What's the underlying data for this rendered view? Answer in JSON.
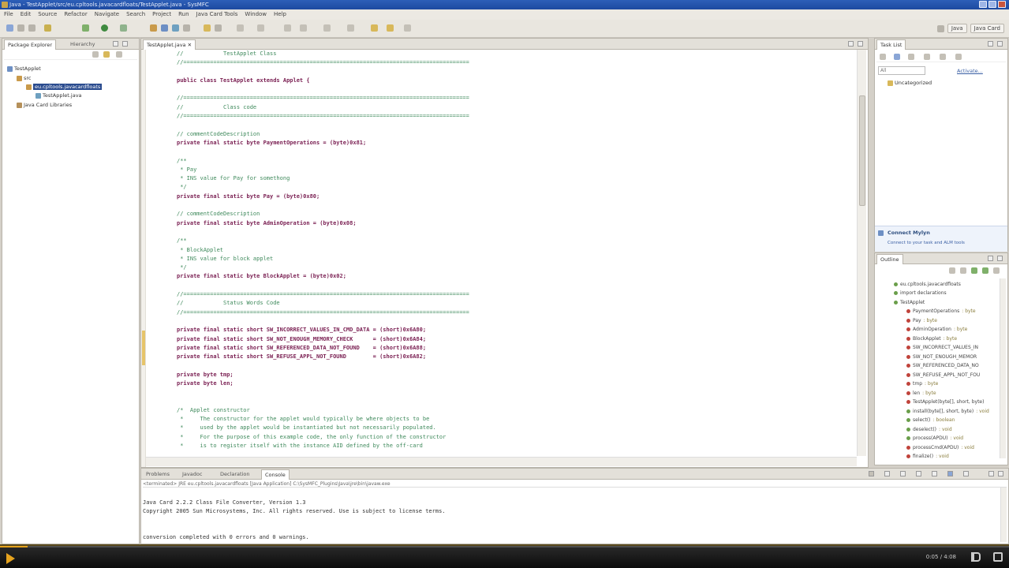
{
  "window": {
    "title": "Java - TestApplet/src/eu.cpltools.javacardfloats/TestApplet.java - SysMFC"
  },
  "menu": [
    "File",
    "Edit",
    "Source",
    "Refactor",
    "Navigate",
    "Search",
    "Project",
    "Run",
    "Java Card Tools",
    "Window",
    "Help"
  ],
  "perspective": {
    "java": "Java",
    "other": "Java Card"
  },
  "explorer": {
    "tabs": [
      "Package Explorer",
      "Hierarchy"
    ],
    "tree": [
      "TestApplet",
      "src",
      "eu.cpltools.javacardfloats",
      "TestApplet.java",
      "Java Card Libraries"
    ]
  },
  "editor": {
    "tab": "TestApplet.java",
    "lines": [
      {
        "t": "c",
        "s": "//            TestApplet Class"
      },
      {
        "t": "c",
        "s": "//======================================================================================"
      },
      {
        "t": "",
        "s": ""
      },
      {
        "t": "k",
        "s": "public class TestApplet extends Applet {"
      },
      {
        "t": "",
        "s": ""
      },
      {
        "t": "c",
        "s": "//======================================================================================"
      },
      {
        "t": "c",
        "s": "//            Class code"
      },
      {
        "t": "c",
        "s": "//======================================================================================"
      },
      {
        "t": "",
        "s": ""
      },
      {
        "t": "c",
        "s": "// commentCodeDescription"
      },
      {
        "t": "k",
        "s": "private final static byte PaymentOperations = (byte)0x81;"
      },
      {
        "t": "",
        "s": ""
      },
      {
        "t": "c",
        "s": "/**"
      },
      {
        "t": "c",
        "s": " * Pay"
      },
      {
        "t": "c",
        "s": " * INS value for Pay for somethong"
      },
      {
        "t": "c",
        "s": " */"
      },
      {
        "t": "k",
        "s": "private final static byte Pay = (byte)0x80;"
      },
      {
        "t": "",
        "s": ""
      },
      {
        "t": "c",
        "s": "// commentCodeDescription"
      },
      {
        "t": "k",
        "s": "private final static byte AdminOperation = (byte)0x08;"
      },
      {
        "t": "",
        "s": ""
      },
      {
        "t": "c",
        "s": "/**"
      },
      {
        "t": "c",
        "s": " * BlockApplet"
      },
      {
        "t": "c",
        "s": " * INS value for block applet"
      },
      {
        "t": "c",
        "s": " */"
      },
      {
        "t": "k",
        "s": "private final static byte BlockApplet = (byte)0x02;"
      },
      {
        "t": "",
        "s": ""
      },
      {
        "t": "c",
        "s": "//======================================================================================"
      },
      {
        "t": "c",
        "s": "//            Status Words Code"
      },
      {
        "t": "c",
        "s": "//======================================================================================"
      },
      {
        "t": "",
        "s": ""
      },
      {
        "t": "k",
        "s": "private final static short SW_INCORRECT_VALUES_IN_CMD_DATA = (short)0x6A80;"
      },
      {
        "t": "k",
        "s": "private final static short SW_NOT_ENOUGH_MEMORY_CHECK      = (short)0x6A84;"
      },
      {
        "t": "k",
        "s": "private final static short SW_REFERENCED_DATA_NOT_FOUND    = (short)0x6A88;"
      },
      {
        "t": "k",
        "s": "private final static short SW_REFUSE_APPL_NOT_FOUND        = (short)0x6A82;"
      },
      {
        "t": "",
        "s": ""
      },
      {
        "t": "k",
        "s": "private byte tmp;"
      },
      {
        "t": "k",
        "s": "private byte len;"
      },
      {
        "t": "",
        "s": ""
      },
      {
        "t": "",
        "s": ""
      },
      {
        "t": "c",
        "s": "/*  Applet constructor"
      },
      {
        "t": "c",
        "s": " *     The constructor for the applet would typically be where objects to be"
      },
      {
        "t": "c",
        "s": " *     used by the applet would be instantiated but not necessarily populated."
      },
      {
        "t": "c",
        "s": " *     For the purpose of this example code, the only function of the constructor"
      },
      {
        "t": "c",
        "s": " *     is to register itself with the instance AID defined by the off-card"
      }
    ]
  },
  "console": {
    "tabs": [
      "Problems",
      "Javadoc",
      "Declaration",
      "Console"
    ],
    "path": "<terminated> JRE eu.cpltools.javacardfloats [Java Application] C:\\SysMFC_Plugins\\Java\\jre\\bin\\javaw.exe",
    "lines": [
      "Java Card 2.2.2 Class File Converter, Version 1.3",
      "Copyright 2005 Sun Microsystems, Inc. All rights reserved. Use is subject to license terms.",
      "",
      "",
      "conversion completed with 0 errors and 0 warnings."
    ]
  },
  "tasks": {
    "tab": "Task List",
    "find_label": "All",
    "activate_label": "Activate...",
    "uncategorized": "Uncategorized",
    "connect_title": "Connect Mylyn",
    "connect_text": "Connect to your task and ALM tools"
  },
  "outline": {
    "tab": "Outline",
    "items": [
      {
        "name": "eu.cpltools.javacardfloats",
        "type": "",
        "c": "green"
      },
      {
        "name": "import declarations",
        "type": "",
        "c": "green"
      },
      {
        "name": "TestApplet",
        "type": "",
        "c": "green"
      },
      {
        "name": "PaymentOperations",
        "type": ": byte",
        "c": "red"
      },
      {
        "name": "Pay",
        "type": ": byte",
        "c": "red"
      },
      {
        "name": "AdminOperation",
        "type": ": byte",
        "c": "red"
      },
      {
        "name": "BlockApplet",
        "type": ": byte",
        "c": "red"
      },
      {
        "name": "SW_INCORRECT_VALUES_IN",
        "type": "",
        "c": "red"
      },
      {
        "name": "SW_NOT_ENOUGH_MEMOR",
        "type": "",
        "c": "red"
      },
      {
        "name": "SW_REFERENCED_DATA_NO",
        "type": "",
        "c": "red"
      },
      {
        "name": "SW_REFUSE_APPL_NOT_FOU",
        "type": "",
        "c": "red"
      },
      {
        "name": "tmp",
        "type": ": byte",
        "c": "red"
      },
      {
        "name": "len",
        "type": ": byte",
        "c": "red"
      },
      {
        "name": "TestApplet(byte[], short, byte)",
        "type": "",
        "c": "red"
      },
      {
        "name": "install(byte[], short, byte)",
        "type": ": void",
        "c": "green"
      },
      {
        "name": "select()",
        "type": ": boolean",
        "c": "green"
      },
      {
        "name": "deselect()",
        "type": ": void",
        "c": "green"
      },
      {
        "name": "process(APDU)",
        "type": ": void",
        "c": "green"
      },
      {
        "name": "processCmd(APDU)",
        "type": ": void",
        "c": "red"
      },
      {
        "name": "finalize()",
        "type": ": void",
        "c": "red"
      }
    ]
  },
  "player": {
    "time": "0:05 / 4:08",
    "progress": 0.027
  }
}
